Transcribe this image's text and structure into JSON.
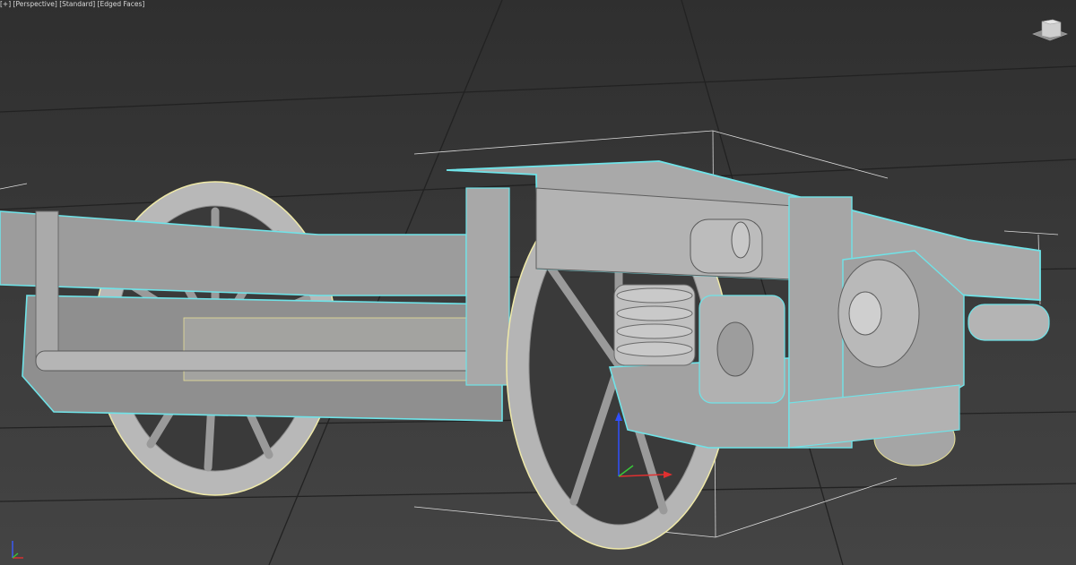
{
  "viewport": {
    "menu_label": "[+]",
    "view_label": "[Perspective]",
    "shading_label": "[Standard]",
    "display_label": "[Edged Faces]"
  },
  "navigation": {
    "viewcube_icon": "viewcube-icon",
    "world_axis_icon": "world-axis-tripod-icon"
  },
  "selection": {
    "highlight_color": "#6fe3e8",
    "bounding_box_color": "#d8d8d8"
  },
  "gizmo": {
    "x_axis_color": "#e03030",
    "y_axis_color": "#38c838",
    "z_axis_color": "#3050ff"
  }
}
